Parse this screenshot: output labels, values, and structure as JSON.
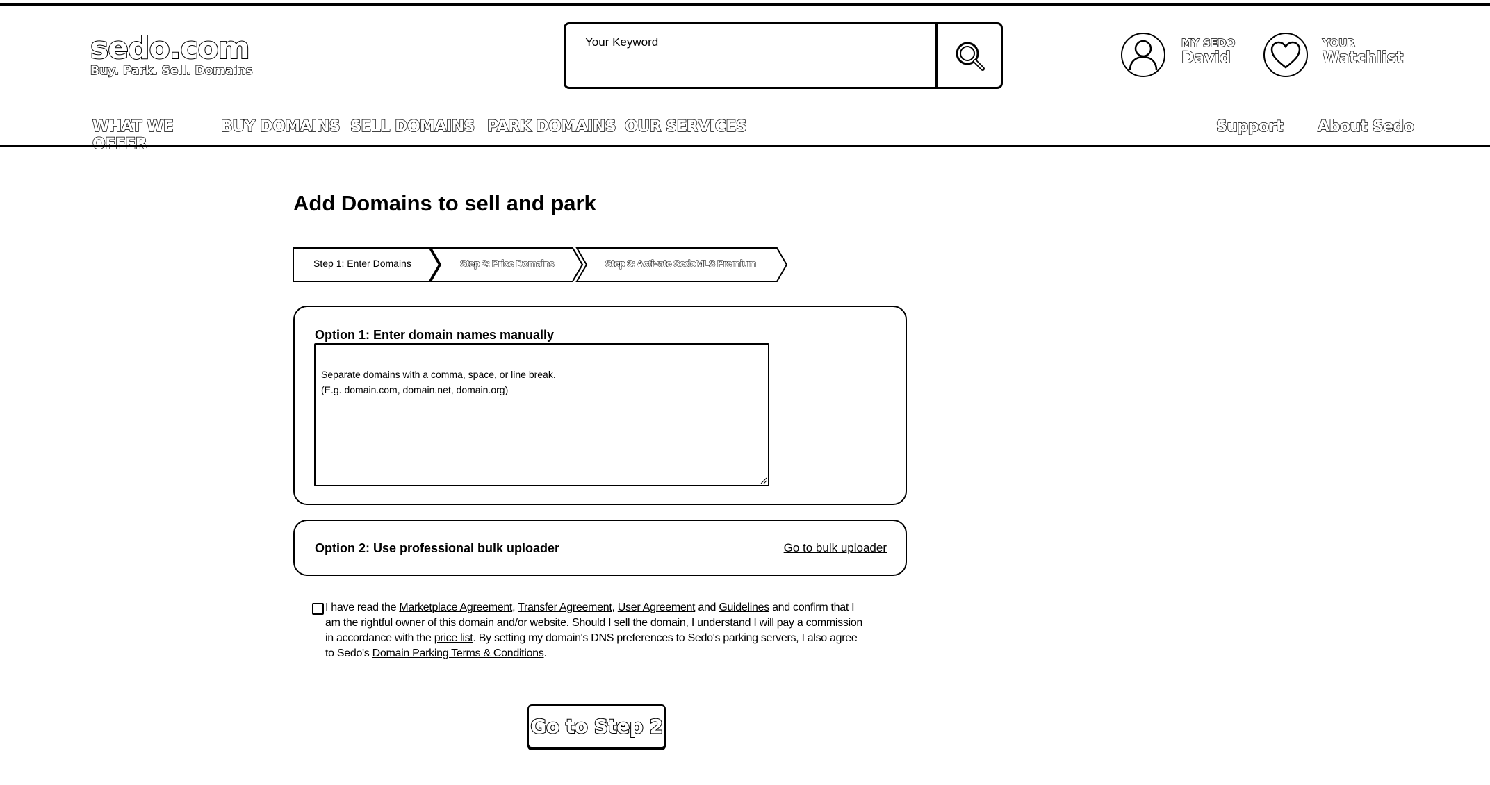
{
  "header": {
    "logo": {
      "main": "sedo.com",
      "tagline": [
        "Buy.",
        "Park.",
        "Sell.",
        "Domains"
      ]
    },
    "search": {
      "placeholder": "Your Keyword"
    },
    "account": {
      "caption": "MY SEDO",
      "name": "David"
    },
    "watchlist": {
      "caption": "YOUR",
      "label": "Watchlist"
    }
  },
  "nav": {
    "left": [
      "WHAT WE OFFER",
      "BUY DOMAINS",
      "SELL DOMAINS",
      "PARK DOMAINS",
      "OUR SERVICES"
    ],
    "right": [
      "Support",
      "About Sedo"
    ]
  },
  "page": {
    "title": "Add Domains to sell and park"
  },
  "steps": [
    {
      "label": "Step 1: Enter Domains",
      "active": true
    },
    {
      "label": "Step 2: Price Domains",
      "active": false
    },
    {
      "label": "Step 3: Activate SedoMLS Premium",
      "active": false
    }
  ],
  "option1": {
    "title": "Option 1: Enter domain names manually",
    "placeholder": "Separate domains with a comma, space, or line break.\n(E.g. domain.com, domain.net, domain.org)"
  },
  "option2": {
    "title": "Option 2: Use professional bulk uploader",
    "link": "Go to bulk uploader"
  },
  "agreement": {
    "t1": "I have read the ",
    "link1": "Marketplace Agreement",
    "t2": ", ",
    "link2": "Transfer Agreement",
    "t3": ", ",
    "link3": "User Agreement",
    "t4": " and ",
    "link4": "Guidelines",
    "t5": " and confirm that I am the rightful owner of this domain and/or website. Should I sell the domain, I understand I will pay a commission in accordance with the ",
    "link5": "price list",
    "t6": ". By setting my domain's DNS preferences to Sedo's parking servers, I also agree to Sedo's ",
    "link6": "Domain Parking Terms & Conditions",
    "t7": "."
  },
  "submit": {
    "label": "Go to Step 2"
  }
}
